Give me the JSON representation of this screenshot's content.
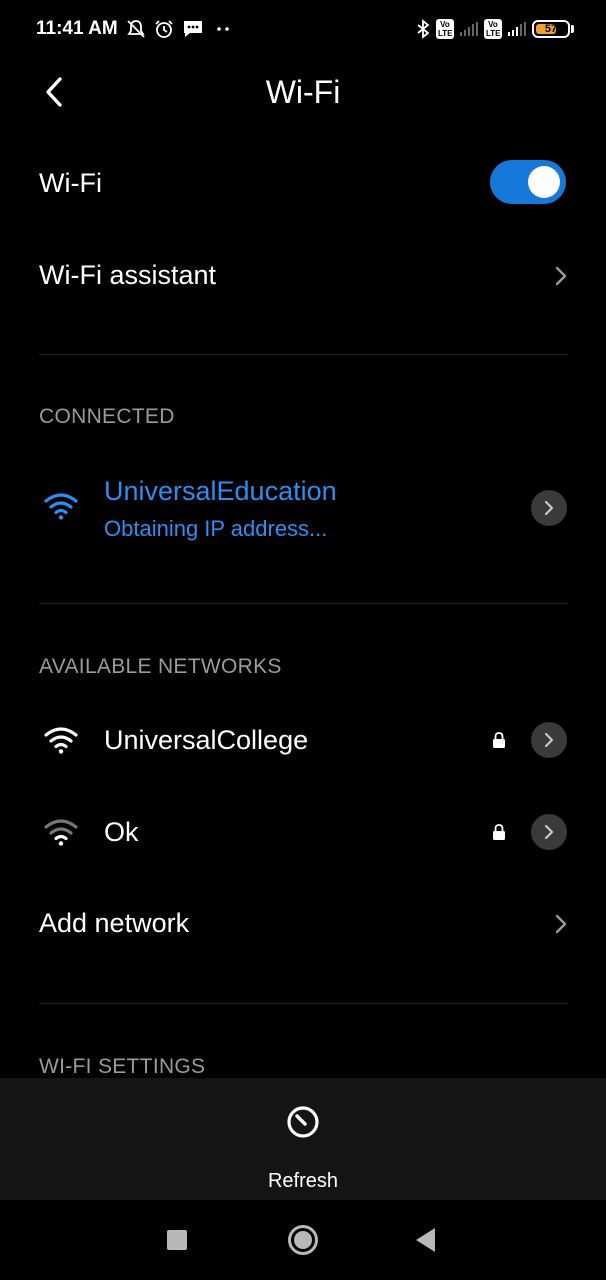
{
  "status_bar": {
    "time": "11:41 AM",
    "left_icons": [
      "notifications-off-icon",
      "alarm-icon",
      "message-icon",
      "more-dots-icon"
    ],
    "right_icons": [
      "bluetooth-icon",
      "volte-icon",
      "signal-icon",
      "volte-icon",
      "signal-icon",
      "battery-icon"
    ],
    "volte_label": "Vo LTE",
    "battery_level": "57",
    "battery_color": "#f0a030"
  },
  "header": {
    "title": "Wi-Fi",
    "back_icon": "back-arrow-icon"
  },
  "wifi_toggle": {
    "label": "Wi-Fi",
    "enabled": true,
    "accent_color": "#1678d9"
  },
  "wifi_assistant": {
    "label": "Wi-Fi assistant"
  },
  "connected": {
    "section_label": "CONNECTED",
    "network": {
      "name": "UniversalEducation",
      "status": "Obtaining IP address...",
      "color": "#2b8ef0"
    }
  },
  "available": {
    "section_label": "AVAILABLE NETWORKS",
    "networks": [
      {
        "name": "UniversalCollege",
        "secured": true,
        "signal": "strong"
      },
      {
        "name": "Ok",
        "secured": true,
        "signal": "weak"
      }
    ],
    "add_network_label": "Add network"
  },
  "wifi_settings": {
    "section_label": "WI-FI SETTINGS"
  },
  "action_bar": {
    "refresh_label": "Refresh",
    "refresh_icon": "refresh-icon"
  },
  "nav_bar": {
    "buttons": [
      "recent-apps-icon",
      "home-icon",
      "back-triangle-icon"
    ]
  }
}
